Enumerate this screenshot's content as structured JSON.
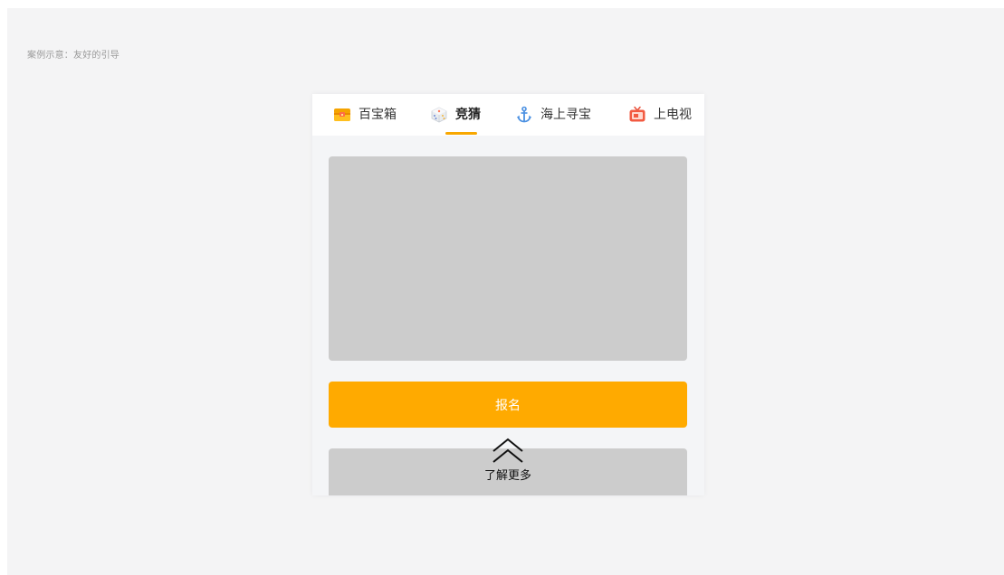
{
  "caption": "案例示意：友好的引导",
  "tabs": [
    {
      "label": "百宝箱",
      "icon": "treasure-chest-icon",
      "active": false
    },
    {
      "label": "竞猜",
      "icon": "dice-icon",
      "active": true
    },
    {
      "label": "海上寻宝",
      "icon": "anchor-icon",
      "active": false
    },
    {
      "label": "上电视",
      "icon": "tv-icon",
      "active": false
    }
  ],
  "signup_label": "报名",
  "more_label": "了解更多",
  "colors": {
    "accent": "#ffaa00",
    "indicator": "#f8a700",
    "placeholder": "#cccccc",
    "page_bg": "#f4f4f5"
  }
}
